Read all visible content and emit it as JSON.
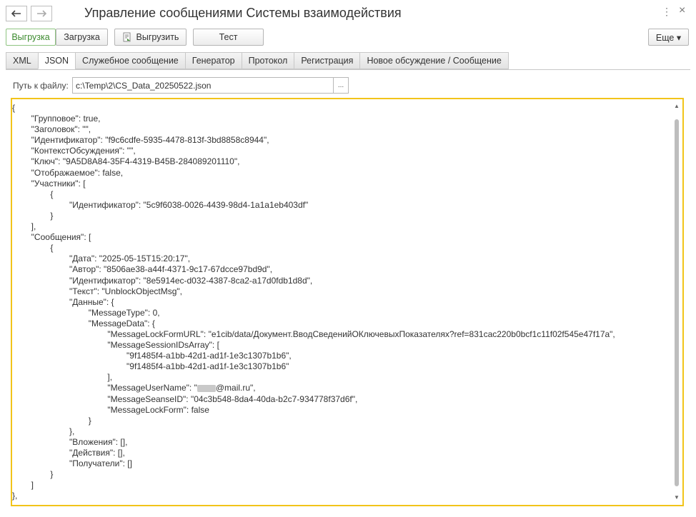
{
  "window": {
    "title": "Управление сообщениями Системы взаимодействия",
    "more_icon": "⋮",
    "close_icon": "×"
  },
  "toolbar": {
    "mode_export": "Выгрузка",
    "mode_import": "Загрузка",
    "export_button": "Выгрузить",
    "test_button": "Тест",
    "more_button": "Еще ▾"
  },
  "tabs": [
    {
      "label": "XML"
    },
    {
      "label": "JSON"
    },
    {
      "label": "Служебное сообщение"
    },
    {
      "label": "Генератор"
    },
    {
      "label": "Протокол"
    },
    {
      "label": "Регистрация"
    },
    {
      "label": "Новое обсуждение / Сообщение"
    }
  ],
  "path": {
    "label": "Путь к файлу:",
    "value": "c:\\Temp\\2\\CS_Data_20250522.json",
    "choose": "..."
  },
  "editor": {
    "lines": [
      "{",
      "\t\t\"Групповое\": true,",
      "\t\t\"Заголовок\": \"\",",
      "\t\t\"Идентификатор\": \"f9c6cdfe-5935-4478-813f-3bd8858c8944\",",
      "\t\t\"КонтекстОбсуждения\": \"\",",
      "\t\t\"Ключ\": \"9A5D8A84-35F4-4319-B45B-284089201110\",",
      "\t\t\"Отображаемое\": false,",
      "\t\t\"Участники\": [",
      "\t\t\t\t{",
      "\t\t\t\t\t\t\"Идентификатор\": \"5c9f6038-0026-4439-98d4-1a1a1eb403df\"",
      "\t\t\t\t}",
      "\t\t],",
      "\t\t\"Сообщения\": [",
      "\t\t\t\t{",
      "\t\t\t\t\t\t\"Дата\": \"2025-05-15T15:20:17\",",
      "\t\t\t\t\t\t\"Автор\": \"8506ae38-a44f-4371-9c17-67dcce97bd9d\",",
      "\t\t\t\t\t\t\"Идентификатор\": \"8e5914ec-d032-4387-8ca2-a17d0fdb1d8d\",",
      "\t\t\t\t\t\t\"Текст\": \"UnblockObjectMsg\",",
      "\t\t\t\t\t\t\"Данные\": {",
      "\t\t\t\t\t\t\t\t\"MessageType\": 0,",
      "\t\t\t\t\t\t\t\t\"MessageData\": {",
      "\t\t\t\t\t\t\t\t\t\t\"MessageLockFormURL\": \"e1cib/data/Документ.ВводСведенийОКлючевыхПоказателях?ref=831cac220b0bcf1c11f02f545e47f17a\",",
      "\t\t\t\t\t\t\t\t\t\t\"MessageSessionIDsArray\": [",
      "\t\t\t\t\t\t\t\t\t\t\t\t\"9f1485f4-a1bb-42d1-ad1f-1e3c1307b1b6\",",
      "\t\t\t\t\t\t\t\t\t\t\t\t\"9f1485f4-a1bb-42d1-ad1f-1e3c1307b1b6\"",
      "\t\t\t\t\t\t\t\t\t\t],",
      "\t\t\t\t\t\t\t\t\t\t\"MessageUserName\": \"",
      "\t\t\t\t\t\t\t\t\t\t\"MessageSeanseID\": \"04c3b548-8da4-40da-b2c7-934778f37d6f\",",
      "\t\t\t\t\t\t\t\t\t\t\"MessageLockForm\": false",
      "\t\t\t\t\t\t\t\t}",
      "\t\t\t\t\t\t},",
      "\t\t\t\t\t\t\"Вложения\": [],",
      "\t\t\t\t\t\t\"Действия\": [],",
      "\t\t\t\t\t\t\"Получатели\": []",
      "\t\t\t\t}",
      "\t\t]",
      "},"
    ],
    "username_suffix": "@mail.ru\","
  },
  "colors": {
    "accent_border": "#f2c41a",
    "export_green": "#3c8a2e"
  }
}
